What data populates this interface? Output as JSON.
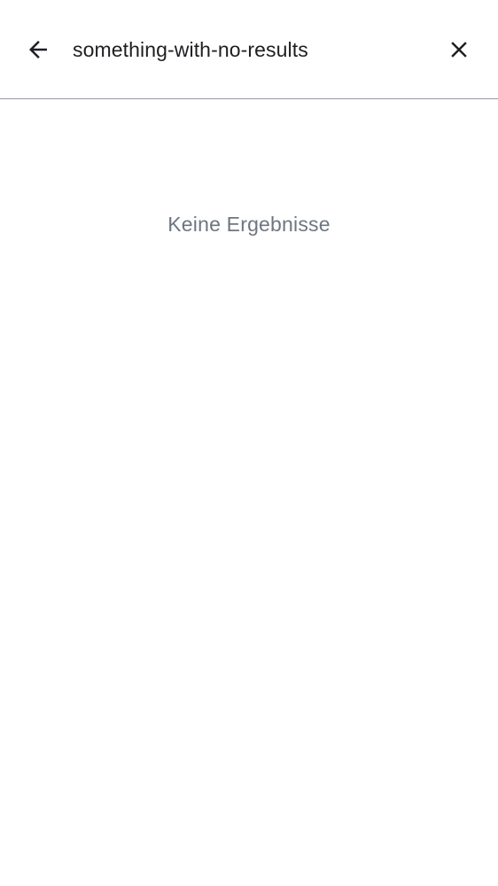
{
  "search": {
    "value": "something-with-no-results"
  },
  "icons": {
    "back": "arrow-back-icon",
    "clear": "close-icon"
  },
  "results": {
    "empty_message": "Keine Ergebnisse"
  },
  "colors": {
    "text_primary": "#1f1f23",
    "text_secondary": "#6e7680",
    "divider": "#9a99a3",
    "background": "#ffffff"
  }
}
